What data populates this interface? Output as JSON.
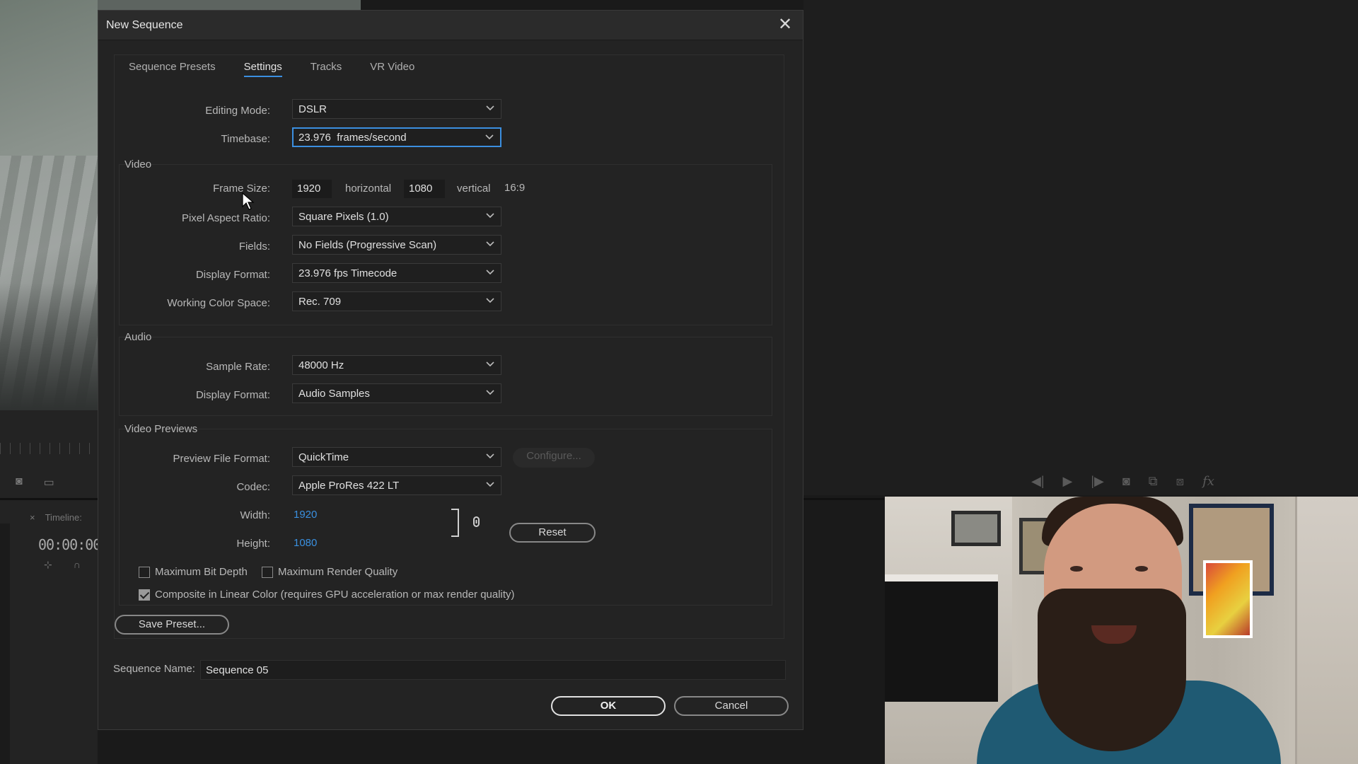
{
  "dialog": {
    "title": "New Sequence",
    "close_glyph": "✕",
    "tabs": [
      {
        "label": "Sequence Presets",
        "active": false
      },
      {
        "label": "Settings",
        "active": true
      },
      {
        "label": "Tracks",
        "active": false
      },
      {
        "label": "VR Video",
        "active": false
      }
    ]
  },
  "settings": {
    "editing_mode": {
      "label": "Editing Mode:",
      "value": "DSLR"
    },
    "timebase": {
      "label": "Timebase:",
      "value": "23.976  frames/second"
    },
    "video": {
      "title": "Video",
      "frame_size": {
        "label": "Frame Size:",
        "width": "1920",
        "width_unit": "horizontal",
        "height": "1080",
        "height_unit": "vertical",
        "aspect": "16:9"
      },
      "pixel_aspect_ratio": {
        "label": "Pixel Aspect Ratio:",
        "value": "Square Pixels (1.0)"
      },
      "fields": {
        "label": "Fields:",
        "value": "No Fields (Progressive Scan)"
      },
      "display_format": {
        "label": "Display Format:",
        "value": "23.976 fps Timecode"
      },
      "working_color_space": {
        "label": "Working Color Space:",
        "value": "Rec. 709"
      }
    },
    "audio": {
      "title": "Audio",
      "sample_rate": {
        "label": "Sample Rate:",
        "value": "48000 Hz"
      },
      "display_format": {
        "label": "Display Format:",
        "value": "Audio Samples"
      }
    },
    "video_previews": {
      "title": "Video Previews",
      "preview_file_format": {
        "label": "Preview File Format:",
        "value": "QuickTime"
      },
      "configure_label": "Configure...",
      "codec": {
        "label": "Codec:",
        "value": "Apple ProRes 422 LT"
      },
      "width": {
        "label": "Width:",
        "value": "1920"
      },
      "height": {
        "label": "Height:",
        "value": "1080"
      },
      "reset_label": "Reset",
      "max_bit_depth": {
        "label": "Maximum Bit Depth",
        "checked": false
      },
      "max_render_quality": {
        "label": "Maximum Render Quality",
        "checked": false
      },
      "composite_linear": {
        "label": "Composite in Linear Color (requires GPU acceleration or max render quality)",
        "checked": true
      }
    },
    "save_preset_label": "Save Preset..."
  },
  "sequence_name": {
    "label": "Sequence Name:",
    "value": "Sequence 05"
  },
  "footer": {
    "ok_label": "OK",
    "cancel_label": "Cancel"
  },
  "background": {
    "timeline_tab": "Timeline:",
    "timeline_close": "×",
    "timecode": "00:00:00"
  },
  "colors": {
    "accent": "#3b8fe0",
    "dialog_bg": "#232323",
    "link_value": "#3a90e0"
  }
}
